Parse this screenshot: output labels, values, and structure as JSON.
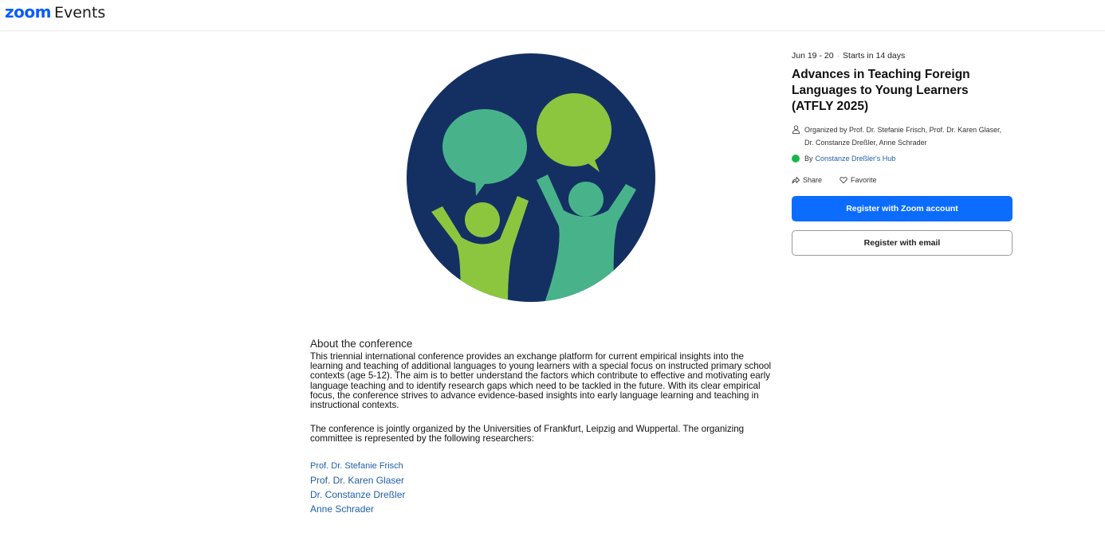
{
  "header": {
    "logo_zoom": "zoom",
    "logo_events": "Events"
  },
  "event": {
    "date": "Jun 19 - 20",
    "separator": "·",
    "starts_in": "Starts in 14 days",
    "title": "Advances in Teaching Foreign Languages to Young Learners (ATFLY 2025)",
    "organized_by": "Organized by Prof. Dr. Stefanie Frisch, Prof. Dr. Karen Glaser, Dr. Constanze Dreßler, Anne Schrader",
    "hub_prefix": "By",
    "hub_name": "Constanze Dreßler's Hub",
    "share_label": "Share",
    "favorite_label": "Favorite",
    "register_zoom_label": "Register with Zoom account",
    "register_email_label": "Register with email"
  },
  "about": {
    "heading": "About the conference",
    "paragraph1": "This triennial international conference provides an exchange platform for current empirical insights into the learning and teaching of additional languages to young learners with a special focus on instructed primary school contexts (age 5-12). The aim is to better understand the factors which contribute to effective and motivating early language teaching and to identify research gaps which need to be tackled in the future. With its clear empirical focus, the conference strives to advance evidence-based insights into early language learning and teaching in instructional contexts.",
    "paragraph2": "The conference is jointly organized by the Universities of Frankfurt, Leipzig and Wuppertal. The organizing committee is represented by the following researchers:",
    "researchers": [
      "Prof. Dr. Stefanie Frisch",
      "Prof. Dr. Karen Glaser",
      "Dr. Constanze Dreßler",
      "Anne Schrader"
    ]
  },
  "colors": {
    "brand_blue": "#0b5cff",
    "primary_button": "#0b6cff",
    "hub_dot": "#17b84a",
    "link": "#1f5fa8",
    "logo_navy": "#143063",
    "logo_teal": "#48b38a",
    "logo_lime": "#8cc63f"
  },
  "icons": {
    "organizer": "person-icon",
    "share": "share-icon",
    "favorite": "heart-icon"
  }
}
